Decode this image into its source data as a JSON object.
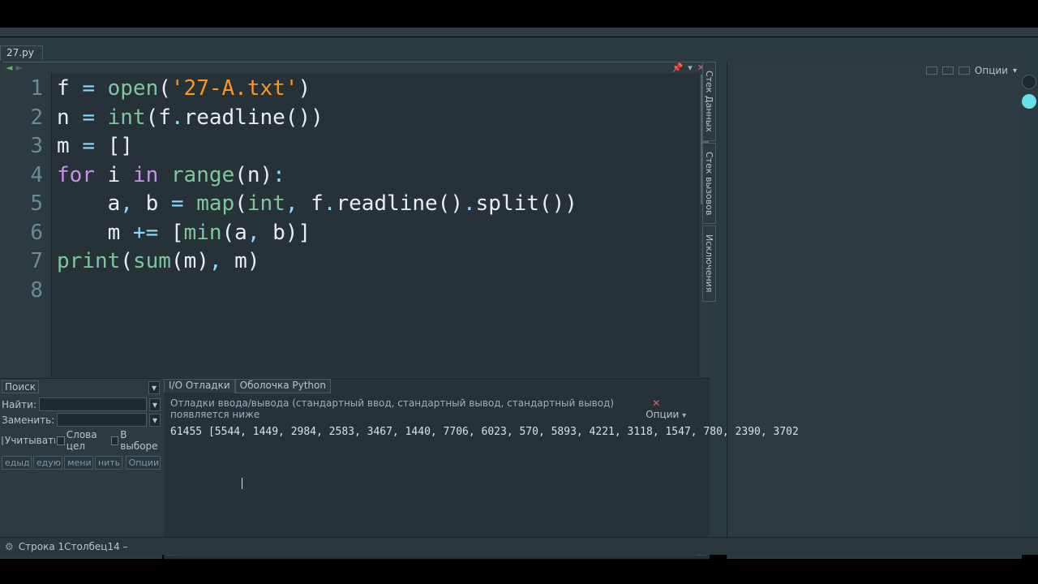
{
  "file_tab": "27.py",
  "nav": {
    "back": "◄",
    "fwd": "►",
    "pin": "📌",
    "chev": "▾",
    "close": "✕"
  },
  "code": {
    "lines": [
      {
        "n": "1",
        "t": [
          [
            "id",
            "f "
          ],
          [
            "op",
            "="
          ],
          [
            "id",
            " "
          ],
          [
            "bi",
            "open"
          ],
          [
            "par",
            "("
          ],
          [
            "str",
            "'27-A.txt'"
          ],
          [
            "par",
            ")"
          ]
        ]
      },
      {
        "n": "2",
        "t": [
          [
            "id",
            "n "
          ],
          [
            "op",
            "="
          ],
          [
            "id",
            " "
          ],
          [
            "bi",
            "int"
          ],
          [
            "par",
            "("
          ],
          [
            "id",
            "f"
          ],
          [
            "op",
            "."
          ],
          [
            "id",
            "readline"
          ],
          [
            "par",
            "()"
          ],
          [
            "par",
            ")"
          ]
        ]
      },
      {
        "n": "3",
        "t": [
          [
            "id",
            "m "
          ],
          [
            "op",
            "="
          ],
          [
            "id",
            " "
          ],
          [
            "par",
            "[]"
          ]
        ]
      },
      {
        "n": "4",
        "t": [
          [
            "kw",
            "for"
          ],
          [
            "id",
            " i "
          ],
          [
            "kw",
            "in"
          ],
          [
            "id",
            " "
          ],
          [
            "bi",
            "range"
          ],
          [
            "par",
            "("
          ],
          [
            "id",
            "n"
          ],
          [
            "par",
            ")"
          ],
          [
            "op",
            ":"
          ]
        ]
      },
      {
        "n": "5",
        "t": [
          [
            "id",
            "    a"
          ],
          [
            "op",
            ","
          ],
          [
            "id",
            " b "
          ],
          [
            "op",
            "="
          ],
          [
            "id",
            " "
          ],
          [
            "bi",
            "map"
          ],
          [
            "par",
            "("
          ],
          [
            "bi",
            "int"
          ],
          [
            "op",
            ","
          ],
          [
            "id",
            " f"
          ],
          [
            "op",
            "."
          ],
          [
            "id",
            "readline"
          ],
          [
            "par",
            "()"
          ],
          [
            "op",
            "."
          ],
          [
            "id",
            "split"
          ],
          [
            "par",
            "()"
          ],
          [
            "par",
            ")"
          ]
        ]
      },
      {
        "n": "6",
        "t": [
          [
            "id",
            "    m "
          ],
          [
            "op",
            "+="
          ],
          [
            "id",
            " "
          ],
          [
            "par",
            "["
          ],
          [
            "bi",
            "min"
          ],
          [
            "par",
            "("
          ],
          [
            "id",
            "a"
          ],
          [
            "op",
            ","
          ],
          [
            "id",
            " b"
          ],
          [
            "par",
            ")"
          ],
          [
            "par",
            "]"
          ]
        ]
      },
      {
        "n": "7",
        "t": [
          [
            "bi",
            "print"
          ],
          [
            "par",
            "("
          ],
          [
            "bi",
            "sum"
          ],
          [
            "par",
            "("
          ],
          [
            "id",
            "m"
          ],
          [
            "par",
            ")"
          ],
          [
            "op",
            ","
          ],
          [
            "id",
            " m"
          ],
          [
            "par",
            ")"
          ]
        ]
      },
      {
        "n": "8",
        "t": [
          [
            "id",
            ""
          ]
        ]
      }
    ]
  },
  "side_tabs": [
    "Стек Данных",
    "Стек вызовов",
    "Исключения"
  ],
  "right_panel": {
    "options": "Опции"
  },
  "search": {
    "title": "Поиск",
    "find_label": "Найти:",
    "replace_label": "Заменить:",
    "find_value": "",
    "replace_value": "",
    "chk_case": "Учитывать",
    "chk_words": "Слова цел",
    "chk_selection": "В выборе",
    "btn_prev": "едыд",
    "btn_next": "едую",
    "btn_replace": "мени",
    "btn_replaceall": "нить",
    "btn_options": "Опции"
  },
  "debug": {
    "tab_io": "I/O Отладки",
    "tab_shell": "Оболочка Python",
    "header_text": "Отладки ввода/вывода (стандартный ввод, стандартный вывод, стандартный вывод) появляется ниже",
    "options": "Опции",
    "output": "61455 [5544, 1449, 2984, 2583, 3467, 1440, 7706, 6023, 570, 5893, 4221, 3118, 1547, 780, 2390, 3702"
  },
  "status": {
    "text": "Строка 1Столбец14 –"
  }
}
